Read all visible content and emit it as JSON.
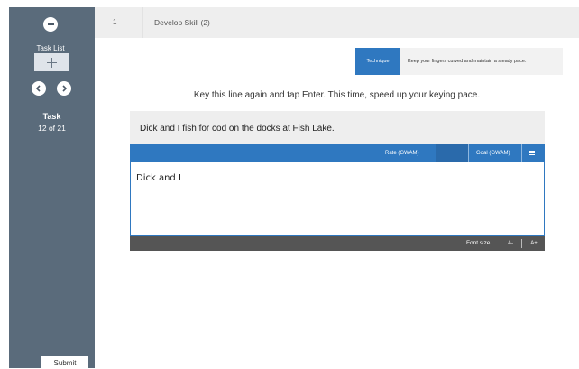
{
  "sidebar": {
    "task_list_label": "Task List",
    "task_title": "Task",
    "task_count": "12 of 21",
    "submit_label": "Submit"
  },
  "header": {
    "step_number": "1",
    "step_title": "Develop Skill (2)"
  },
  "technique": {
    "badge": "Technique",
    "text": "Keep your fingers curved and maintain a steady pace."
  },
  "instruction": "Key this line again and tap Enter. This time, speed up your keying pace.",
  "prompt_line": "Dick and I fish for cod on the docks at Fish Lake.",
  "stats": {
    "rate_label": "Rate (GWAM)",
    "goal_label": "Goal (GWAM)"
  },
  "input_value": "Dick and I",
  "font_controls": {
    "label": "Font size",
    "decrease": "A-",
    "increase": "A+"
  },
  "colors": {
    "sidebar": "#5a6b7b",
    "accent": "#2f78c0",
    "font_bar": "#555555"
  },
  "icons": [
    "minus-icon",
    "plus-icon",
    "chevron-left-icon",
    "chevron-right-icon",
    "menu-icon"
  ]
}
